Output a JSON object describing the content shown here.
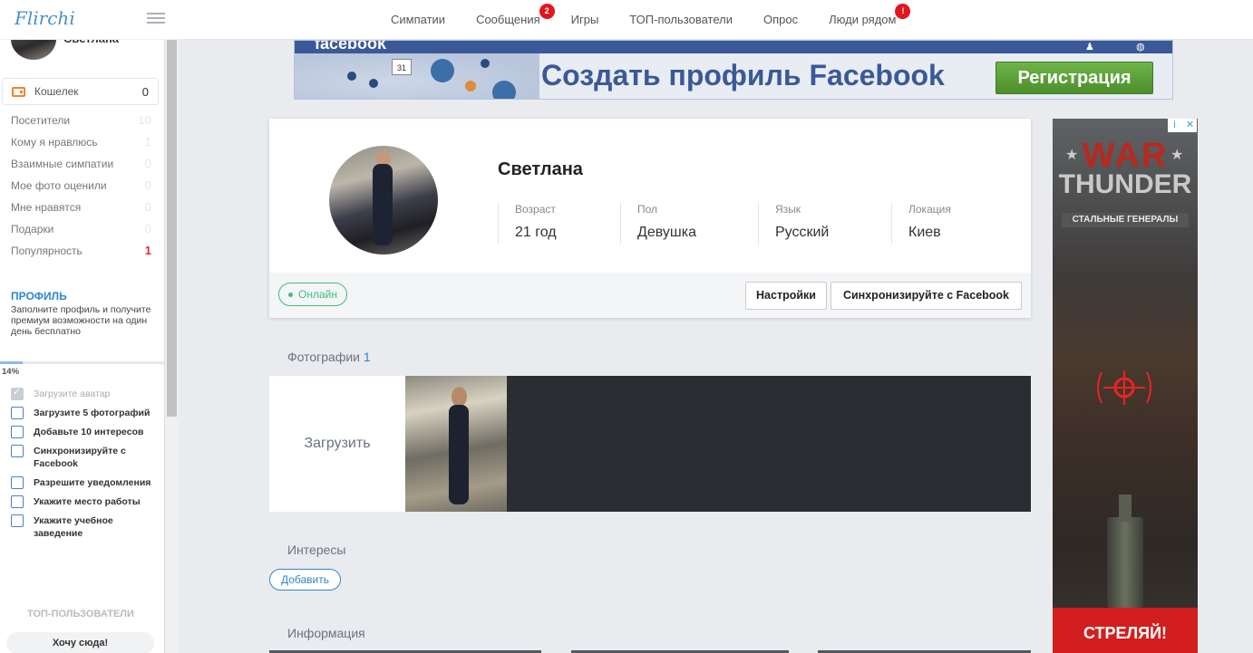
{
  "app": {
    "logo": "Flirchi"
  },
  "nav": {
    "items": [
      {
        "label": "Симпатии",
        "badge": ""
      },
      {
        "label": "Сообщения",
        "badge": "2"
      },
      {
        "label": "Игры",
        "badge": ""
      },
      {
        "label": "ТОП-пользователи",
        "badge": ""
      },
      {
        "label": "Опрос",
        "badge": ""
      },
      {
        "label": "Люди рядом",
        "badge": "!"
      }
    ]
  },
  "sidebar": {
    "user_name": "Светлана",
    "wallet": {
      "label": "Кошелек",
      "count": "0"
    },
    "stats": [
      {
        "label": "Посетители",
        "count": "10"
      },
      {
        "label": "Кому я нравлюсь",
        "count": "1"
      },
      {
        "label": "Взаимные симпатии",
        "count": "0"
      },
      {
        "label": "Мое фото оценили",
        "count": "0"
      },
      {
        "label": "Мне нравятся",
        "count": "0"
      },
      {
        "label": "Подарки",
        "count": "0"
      },
      {
        "label": "Популярность",
        "count": "1"
      }
    ],
    "promo": {
      "title": "ПРОФИЛЬ",
      "text": "Заполните профиль и получите премиум возможности на один день бесплатно"
    },
    "progress": {
      "percent_label": "14%",
      "fraction": 0.14
    },
    "tasks": [
      {
        "label": "Загрузите аватар",
        "done": true
      },
      {
        "label": "Загрузите 5 фотографий",
        "done": false
      },
      {
        "label": "Добавьте 10 интересов",
        "done": false
      },
      {
        "label": "Синхронизируйте с Facebook",
        "done": false
      },
      {
        "label": "Разрешите уведомления",
        "done": false
      },
      {
        "label": "Укажите место работы",
        "done": false
      },
      {
        "label": "Укажите учебное заведение",
        "done": false
      }
    ],
    "top_users_title": "ТОП-ПОЛЬЗОВАТЕЛИ",
    "want_here_button": "Хочу сюда!"
  },
  "fb_banner": {
    "brand": "facebook",
    "calendar_day": "31",
    "headline": "Создать профиль Facebook",
    "register_button": "Регистрация"
  },
  "profile": {
    "name": "Светлана",
    "fields": [
      {
        "label": "Возраст",
        "value": "21 год"
      },
      {
        "label": "Пол",
        "value": "Девушка"
      },
      {
        "label": "Язык",
        "value": "Русский"
      },
      {
        "label": "Локация",
        "value": "Киев"
      }
    ],
    "status": "Онлайн",
    "settings_button": "Настройки",
    "sync_button": "Синхронизируйте с Facebook"
  },
  "photos": {
    "title": "Фотографии",
    "count": "1",
    "upload_label": "Загрузить"
  },
  "interests": {
    "title": "Интересы",
    "add_button": "Добавить"
  },
  "info": {
    "title": "Информация"
  },
  "ad": {
    "title_line1": "WAR",
    "title_line2": "THUNDER",
    "subtitle": "СТАЛЬНЫЕ ГЕНЕРАЛЫ",
    "cta": "СТРЕЛЯЙ!",
    "info_icon": "i",
    "close_icon": "✕"
  },
  "colors": {
    "accent": "#2f86d0",
    "online": "#3ec07c",
    "badge": "#e4151c",
    "facebook": "#3b5998"
  }
}
